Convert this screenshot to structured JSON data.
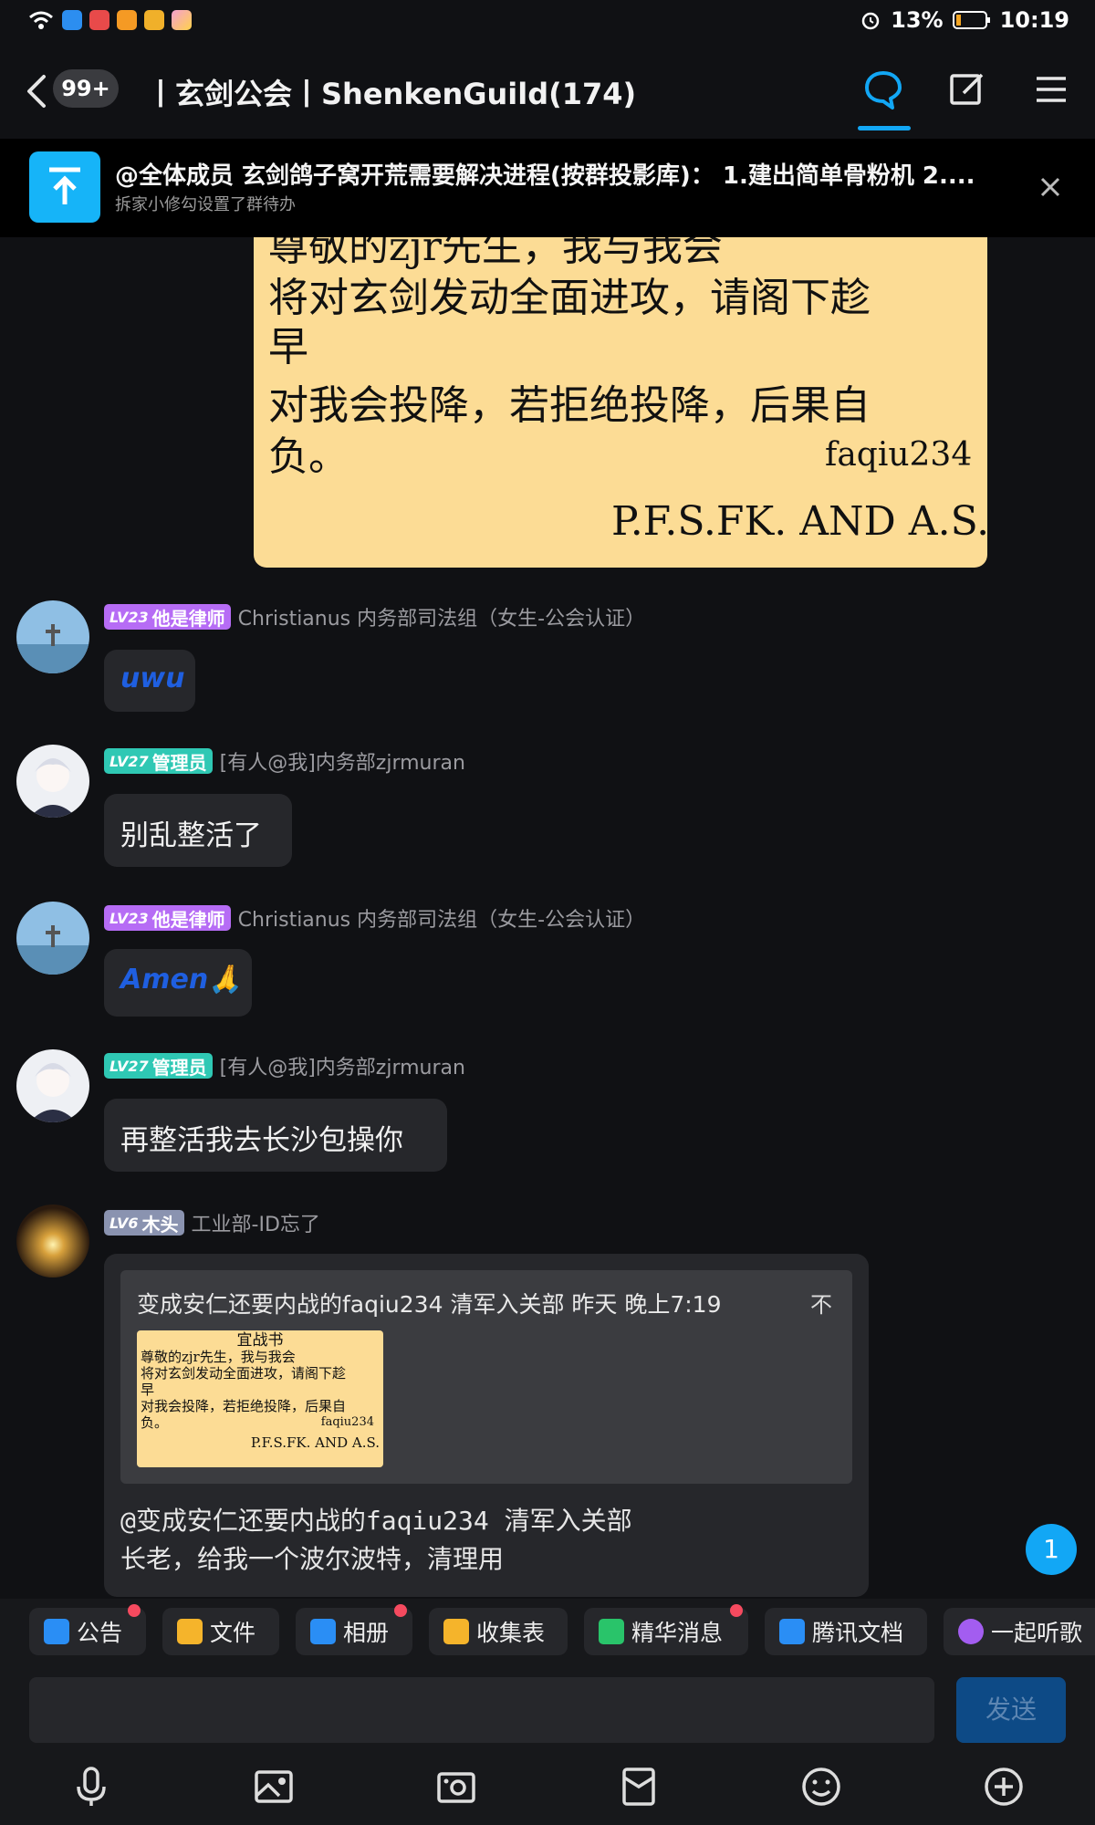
{
  "status_bar": {
    "battery": "13%",
    "time": "10:19"
  },
  "header": {
    "back_badge": "99+",
    "title": "丨玄剑公会丨ShenkenGuild(174)"
  },
  "announcement": {
    "title": "@全体成员 玄剑鸽子窝开荒需要解决进程(按群投影库)： 1.建出简单骨粉机 2....",
    "subtitle": "拆家小修勾设置了群待办"
  },
  "image_message": {
    "lines": [
      "尊敬的zjr先生，我与我会",
      "将对玄剑发动全面进攻，请阁下趁",
      "早",
      "对我会投降，若拒绝投降，后果自",
      "负。",
      "faqiu234",
      "P.F.S.FK. AND A.S."
    ]
  },
  "messages": [
    {
      "level": "LV23",
      "title": "他是律师",
      "title_color": "#b66cf5",
      "name": "Christianus 内务部司法组（女生-公会认证）",
      "text": "uwu"
    },
    {
      "level": "LV27",
      "title": "管理员",
      "title_color": "#2fc8b4",
      "name": "[有人@我]内务部zjrmuran",
      "text": "别乱整活了"
    },
    {
      "level": "LV23",
      "title": "他是律师",
      "title_color": "#b66cf5",
      "name": "Christianus 内务部司法组（女生-公会认证）",
      "text": "Amen🙏"
    },
    {
      "level": "LV27",
      "title": "管理员",
      "title_color": "#2fc8b4",
      "name": "[有人@我]内务部zjrmuran",
      "text": "再整活我去长沙包操你"
    },
    {
      "level": "LV6",
      "title": "木头",
      "title_color": "#8a93b0",
      "name": "工业部-ID忘了"
    }
  ],
  "quote": {
    "header": "变成安仁还要内战的faqiu234 清军入关部 昨天 晚上7:19",
    "pin_icon": "不",
    "image_lines": [
      "宜战书",
      "尊敬的zjr先生，我与我会",
      "将对玄剑发动全面进攻，请阁下趁",
      "早",
      "对我会投降，若拒绝投降，后果自",
      "负。",
      "faqiu234",
      "P.F.S.FK. AND A.S."
    ],
    "reply_line1": "@变成安仁还要内战的faqiu234 清军入关部",
    "reply_line2": "长老，给我一个波尔波特，清理用"
  },
  "unread_count": "1",
  "toolbar": [
    {
      "label": "公告",
      "icon": "announcement-icon",
      "dot": true
    },
    {
      "label": "文件",
      "icon": "folder-icon",
      "dot": false
    },
    {
      "label": "相册",
      "icon": "album-icon",
      "dot": true
    },
    {
      "label": "收集表",
      "icon": "form-icon",
      "dot": false
    },
    {
      "label": "精华消息",
      "icon": "essence-icon",
      "dot": true
    },
    {
      "label": "腾讯文档",
      "icon": "docs-icon",
      "dot": false
    },
    {
      "label": "一起听歌",
      "icon": "music-icon",
      "dot": false
    }
  ],
  "input": {
    "send_label": "发送"
  },
  "colors": {
    "accent": "#12a7f5",
    "background": "#101114",
    "bubble": "#26272b"
  }
}
